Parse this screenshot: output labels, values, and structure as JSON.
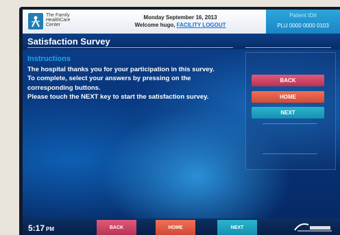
{
  "header": {
    "logo_lines": [
      "The Family",
      "HealthCare",
      "Center"
    ],
    "date": "Monday September 16, 2013",
    "welcome_prefix": "Welcome hugo, ",
    "logout_link": "FACILITY LOGOUT",
    "patient_label": "Patient ID#",
    "patient_id": "PLU 0000 0000 0103"
  },
  "page": {
    "title": "Satisfaction Survey",
    "instructions_heading": "Instructions",
    "instructions": [
      "The hospital thanks you for your participation in this survey.",
      "To complete, select your answers by pressing on the corresponding buttons.",
      "Please touch the NEXT key to start the satisfaction survey."
    ]
  },
  "side_buttons": {
    "back": "BACK",
    "home": "HOME",
    "next": "NEXT"
  },
  "footer": {
    "time": "5:17",
    "ampm": "PM",
    "back": "BACK",
    "home": "HOME",
    "next": "NEXT"
  },
  "colors": {
    "back": "#c93f61",
    "home": "#e35a45",
    "next": "#1fa2c0",
    "accent": "#1aa9e8"
  }
}
